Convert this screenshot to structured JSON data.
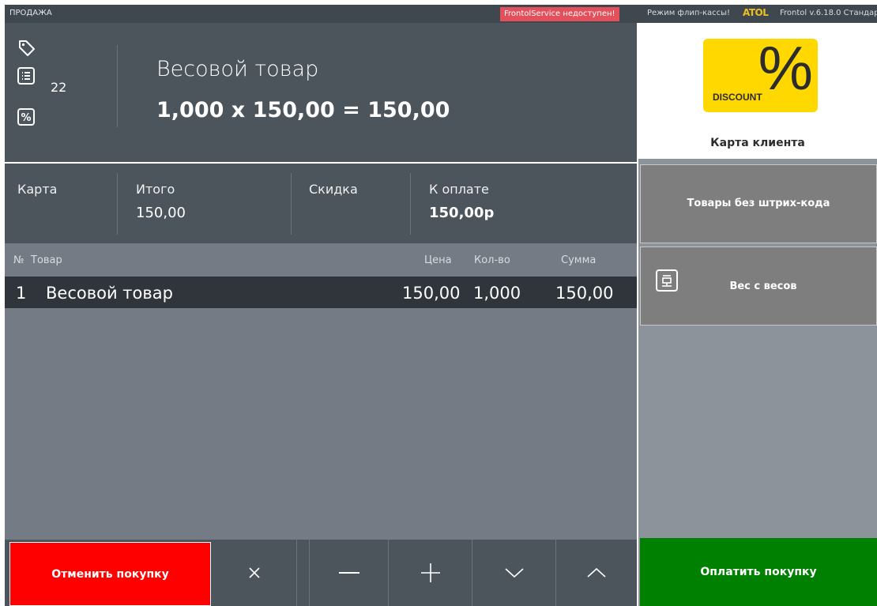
{
  "topbar": {
    "mode": "ПРОДАЖА",
    "service_warning": "FrontolService недоступен!",
    "flip_mode": "Режим флип-кассы!",
    "brand": "ATOL",
    "version": "Frontol v.6.18.0 Стандарт"
  },
  "current_item": {
    "name": "Весовой товар",
    "calculation": "1,000 x 150,00 = 150,00",
    "count": "22"
  },
  "totals": {
    "card_label": "Карта",
    "total_label": "Итого",
    "total_value": "150,00",
    "discount_label": "Скидка",
    "to_pay_label": "К оплате",
    "to_pay_value": "150,00р"
  },
  "table": {
    "headers": {
      "num": "№",
      "item": "Товар",
      "price": "Цена",
      "qty": "Кол-во",
      "sum": "Сумма"
    },
    "rows": [
      {
        "num": "1",
        "item": "Весовой товар",
        "price": "150,00",
        "qty": "1,000",
        "sum": "150,00"
      }
    ]
  },
  "bottom": {
    "cancel_label": "Отменить покупку"
  },
  "right_panel": {
    "card_image_percent": "%",
    "card_image_text": "DISCOUNT",
    "card_label": "Карта клиента",
    "no_barcode_label": "Товары без штрих-кода",
    "weight_label": "Вес с весов",
    "pay_label": "Оплатить покупку"
  },
  "colors": {
    "cancel": "#ff0000",
    "pay": "#008000",
    "warning": "#e34f5a",
    "card": "#ffd800"
  }
}
